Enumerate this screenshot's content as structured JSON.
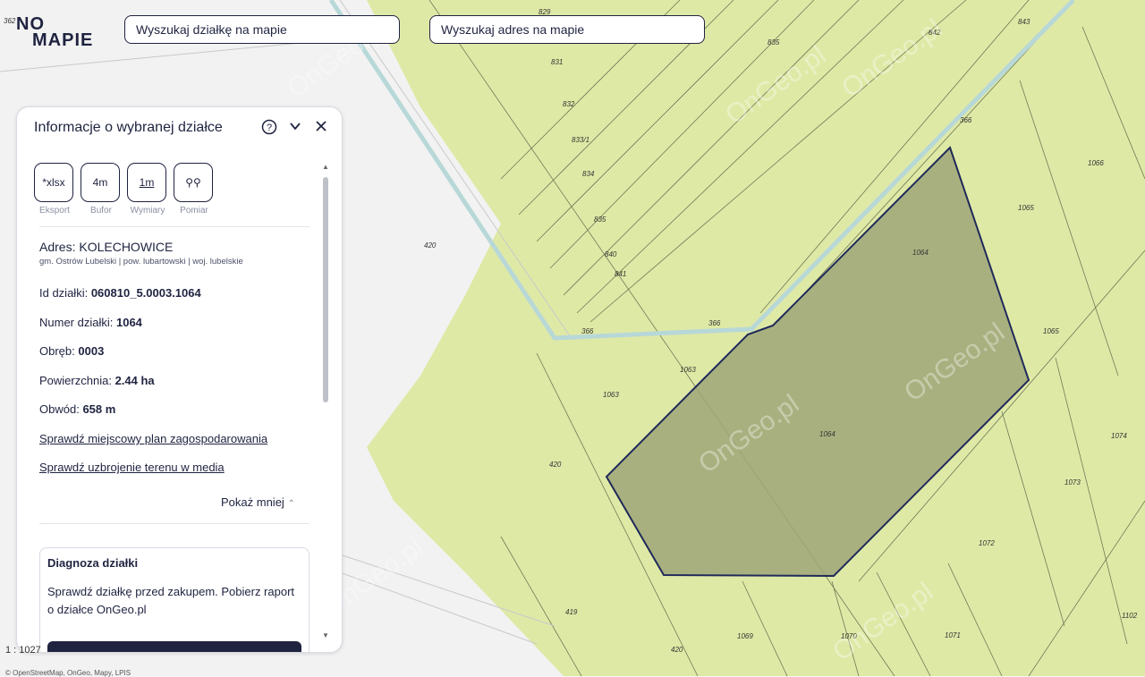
{
  "brand": {
    "logo_line1": "NO",
    "logo_line2": "MAPIE"
  },
  "search": {
    "plot_placeholder": "Wyszukaj działkę na mapie",
    "address_placeholder": "Wyszukaj adres na mapie"
  },
  "panel": {
    "title": "Informacje o wybranej działce",
    "tools": [
      {
        "icon_text": "*xlsx",
        "label": "Eksport",
        "icon": "export-xlsx-icon"
      },
      {
        "icon_text": "4m",
        "label": "Bufor",
        "icon": "buffer-icon"
      },
      {
        "icon_text": "1m",
        "label": "Wymiary",
        "icon": "dimensions-icon"
      },
      {
        "icon_text": "⚲⚲",
        "label": "Pomiar",
        "icon": "measure-icon"
      }
    ],
    "address_label": "Adres:",
    "address_value": "KOLECHOWICE",
    "address_sub": "gm. Ostrów Lubelski | pow. lubartowski | woj. lubelskie",
    "id_label": "Id działki:",
    "id_value": "060810_5.0003.1064",
    "number_label": "Numer działki:",
    "number_value": "1064",
    "precinct_label": "Obręb:",
    "precinct_value": "0003",
    "area_label": "Powierzchnia:",
    "area_value": "2.44 ha",
    "perimeter_label": "Obwód:",
    "perimeter_value": "658 m",
    "link_plan": "Sprawdź miejscowy plan zagospodarowania",
    "link_media": "Sprawdź uzbrojenie terenu w media",
    "toggle_label": "Pokaż mniej",
    "diagnosis_title": "Diagnoza działki",
    "diagnosis_text": "Sprawdź działkę przed zakupem. Pobierz raport o działce OnGeo.pl"
  },
  "map": {
    "scale": "1 : 1027",
    "copyright": "© OpenStreetMap, OnGeo, Mapy, LPIS",
    "watermark": "OnGeo.pl",
    "parcel_labels": [
      "829",
      "831",
      "832",
      "833/1",
      "834",
      "835",
      "835",
      "840",
      "841",
      "842",
      "843",
      "366",
      "366",
      "366",
      "1066",
      "1065",
      "1065",
      "1064",
      "1064",
      "1063",
      "1063",
      "420",
      "420",
      "420",
      "419",
      "1074",
      "1073",
      "1072",
      "1071",
      "1070",
      "1069",
      "1102",
      "362"
    ]
  },
  "colors": {
    "accent": "#1f2340",
    "field": "#dfe9a6",
    "selected_parcel": "#a0a678",
    "water": "#b8d8d8"
  }
}
